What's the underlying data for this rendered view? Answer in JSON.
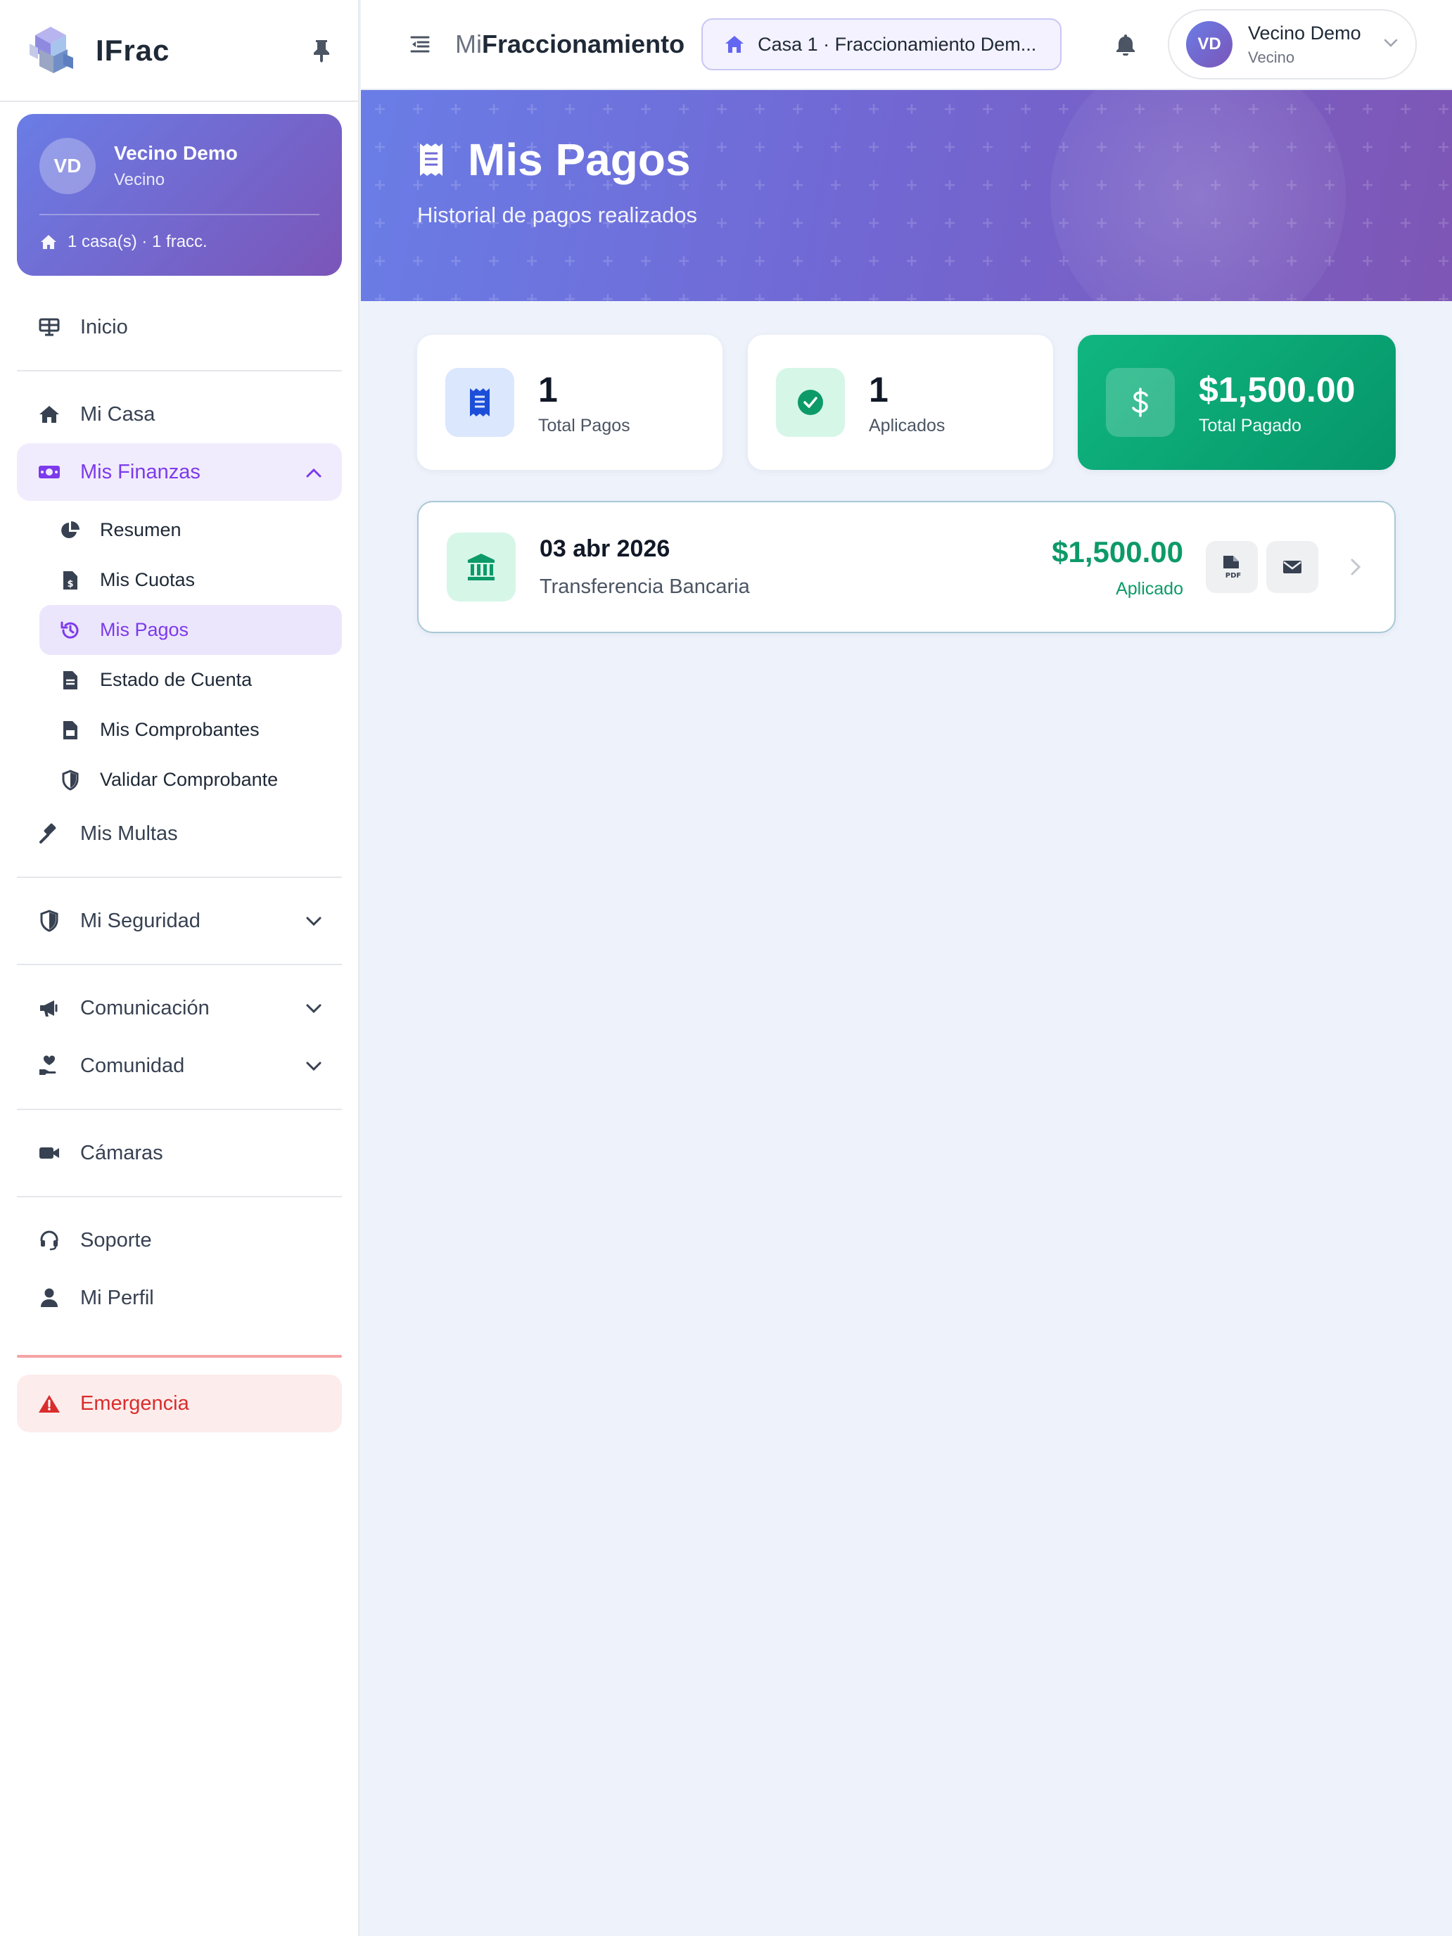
{
  "brand": {
    "name": "IFrac"
  },
  "user_card": {
    "initials": "VD",
    "name": "Vecino Demo",
    "role": "Vecino",
    "meta": "1 casa(s) · 1 fracc."
  },
  "nav": {
    "inicio": "Inicio",
    "mi_casa": "Mi Casa",
    "mis_finanzas": "Mis Finanzas",
    "finanzas_sub": {
      "resumen": "Resumen",
      "mis_cuotas": "Mis Cuotas",
      "mis_pagos": "Mis Pagos",
      "estado_cuenta": "Estado de Cuenta",
      "mis_comprobantes": "Mis Comprobantes",
      "validar_comprobante": "Validar Comprobante"
    },
    "mis_multas": "Mis Multas",
    "mi_seguridad": "Mi Seguridad",
    "comunicacion": "Comunicación",
    "comunidad": "Comunidad",
    "camaras": "Cámaras",
    "soporte": "Soporte",
    "mi_perfil": "Mi Perfil",
    "emergencia": "Emergencia"
  },
  "topbar": {
    "title_prefix": "Mi",
    "title_main": "Fraccionamiento",
    "house_selector": "Casa 1 · Fraccionamiento Dem...",
    "user_initials": "VD",
    "user_name": "Vecino Demo",
    "user_role": "Vecino"
  },
  "hero": {
    "title": "Mis Pagos",
    "subtitle": "Historial de pagos realizados"
  },
  "stats": [
    {
      "value": "1",
      "label": "Total Pagos"
    },
    {
      "value": "1",
      "label": "Aplicados"
    },
    {
      "value": "$1,500.00",
      "label": "Total Pagado"
    }
  ],
  "payments": [
    {
      "date": "03 abr 2026",
      "method": "Transferencia Bancaria",
      "amount": "$1,500.00",
      "status": "Aplicado"
    }
  ],
  "colors": {
    "accent": "#7c3aed",
    "hero_start": "#6a7de6",
    "hero_end": "#7e56b5",
    "success": "#0c9a68",
    "danger": "#d92d2d"
  },
  "icons": {
    "brand": "cube-logo-icon",
    "pin": "pin-icon",
    "menu_toggle": "indent-icon",
    "house": "house-icon",
    "bell": "bell-icon",
    "receipt": "receipt-icon",
    "check": "check-circle-icon",
    "dollar": "dollar-icon",
    "bank": "bank-icon",
    "pdf": "file-pdf-icon",
    "email": "envelope-icon"
  }
}
